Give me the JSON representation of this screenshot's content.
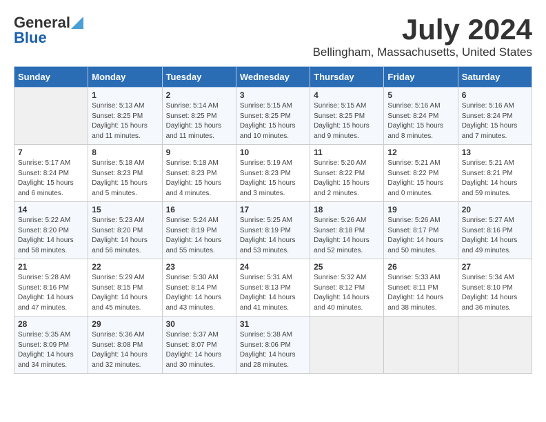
{
  "header": {
    "logo_general": "General",
    "logo_blue": "Blue",
    "month": "July 2024",
    "location": "Bellingham, Massachusetts, United States"
  },
  "weekdays": [
    "Sunday",
    "Monday",
    "Tuesday",
    "Wednesday",
    "Thursday",
    "Friday",
    "Saturday"
  ],
  "weeks": [
    [
      {
        "day": "",
        "empty": true
      },
      {
        "day": "1",
        "sunrise": "Sunrise: 5:13 AM",
        "sunset": "Sunset: 8:25 PM",
        "daylight": "Daylight: 15 hours and 11 minutes."
      },
      {
        "day": "2",
        "sunrise": "Sunrise: 5:14 AM",
        "sunset": "Sunset: 8:25 PM",
        "daylight": "Daylight: 15 hours and 11 minutes."
      },
      {
        "day": "3",
        "sunrise": "Sunrise: 5:15 AM",
        "sunset": "Sunset: 8:25 PM",
        "daylight": "Daylight: 15 hours and 10 minutes."
      },
      {
        "day": "4",
        "sunrise": "Sunrise: 5:15 AM",
        "sunset": "Sunset: 8:25 PM",
        "daylight": "Daylight: 15 hours and 9 minutes."
      },
      {
        "day": "5",
        "sunrise": "Sunrise: 5:16 AM",
        "sunset": "Sunset: 8:24 PM",
        "daylight": "Daylight: 15 hours and 8 minutes."
      },
      {
        "day": "6",
        "sunrise": "Sunrise: 5:16 AM",
        "sunset": "Sunset: 8:24 PM",
        "daylight": "Daylight: 15 hours and 7 minutes."
      }
    ],
    [
      {
        "day": "7",
        "sunrise": "Sunrise: 5:17 AM",
        "sunset": "Sunset: 8:24 PM",
        "daylight": "Daylight: 15 hours and 6 minutes."
      },
      {
        "day": "8",
        "sunrise": "Sunrise: 5:18 AM",
        "sunset": "Sunset: 8:23 PM",
        "daylight": "Daylight: 15 hours and 5 minutes."
      },
      {
        "day": "9",
        "sunrise": "Sunrise: 5:18 AM",
        "sunset": "Sunset: 8:23 PM",
        "daylight": "Daylight: 15 hours and 4 minutes."
      },
      {
        "day": "10",
        "sunrise": "Sunrise: 5:19 AM",
        "sunset": "Sunset: 8:23 PM",
        "daylight": "Daylight: 15 hours and 3 minutes."
      },
      {
        "day": "11",
        "sunrise": "Sunrise: 5:20 AM",
        "sunset": "Sunset: 8:22 PM",
        "daylight": "Daylight: 15 hours and 2 minutes."
      },
      {
        "day": "12",
        "sunrise": "Sunrise: 5:21 AM",
        "sunset": "Sunset: 8:22 PM",
        "daylight": "Daylight: 15 hours and 0 minutes."
      },
      {
        "day": "13",
        "sunrise": "Sunrise: 5:21 AM",
        "sunset": "Sunset: 8:21 PM",
        "daylight": "Daylight: 14 hours and 59 minutes."
      }
    ],
    [
      {
        "day": "14",
        "sunrise": "Sunrise: 5:22 AM",
        "sunset": "Sunset: 8:20 PM",
        "daylight": "Daylight: 14 hours and 58 minutes."
      },
      {
        "day": "15",
        "sunrise": "Sunrise: 5:23 AM",
        "sunset": "Sunset: 8:20 PM",
        "daylight": "Daylight: 14 hours and 56 minutes."
      },
      {
        "day": "16",
        "sunrise": "Sunrise: 5:24 AM",
        "sunset": "Sunset: 8:19 PM",
        "daylight": "Daylight: 14 hours and 55 minutes."
      },
      {
        "day": "17",
        "sunrise": "Sunrise: 5:25 AM",
        "sunset": "Sunset: 8:19 PM",
        "daylight": "Daylight: 14 hours and 53 minutes."
      },
      {
        "day": "18",
        "sunrise": "Sunrise: 5:26 AM",
        "sunset": "Sunset: 8:18 PM",
        "daylight": "Daylight: 14 hours and 52 minutes."
      },
      {
        "day": "19",
        "sunrise": "Sunrise: 5:26 AM",
        "sunset": "Sunset: 8:17 PM",
        "daylight": "Daylight: 14 hours and 50 minutes."
      },
      {
        "day": "20",
        "sunrise": "Sunrise: 5:27 AM",
        "sunset": "Sunset: 8:16 PM",
        "daylight": "Daylight: 14 hours and 49 minutes."
      }
    ],
    [
      {
        "day": "21",
        "sunrise": "Sunrise: 5:28 AM",
        "sunset": "Sunset: 8:16 PM",
        "daylight": "Daylight: 14 hours and 47 minutes."
      },
      {
        "day": "22",
        "sunrise": "Sunrise: 5:29 AM",
        "sunset": "Sunset: 8:15 PM",
        "daylight": "Daylight: 14 hours and 45 minutes."
      },
      {
        "day": "23",
        "sunrise": "Sunrise: 5:30 AM",
        "sunset": "Sunset: 8:14 PM",
        "daylight": "Daylight: 14 hours and 43 minutes."
      },
      {
        "day": "24",
        "sunrise": "Sunrise: 5:31 AM",
        "sunset": "Sunset: 8:13 PM",
        "daylight": "Daylight: 14 hours and 41 minutes."
      },
      {
        "day": "25",
        "sunrise": "Sunrise: 5:32 AM",
        "sunset": "Sunset: 8:12 PM",
        "daylight": "Daylight: 14 hours and 40 minutes."
      },
      {
        "day": "26",
        "sunrise": "Sunrise: 5:33 AM",
        "sunset": "Sunset: 8:11 PM",
        "daylight": "Daylight: 14 hours and 38 minutes."
      },
      {
        "day": "27",
        "sunrise": "Sunrise: 5:34 AM",
        "sunset": "Sunset: 8:10 PM",
        "daylight": "Daylight: 14 hours and 36 minutes."
      }
    ],
    [
      {
        "day": "28",
        "sunrise": "Sunrise: 5:35 AM",
        "sunset": "Sunset: 8:09 PM",
        "daylight": "Daylight: 14 hours and 34 minutes."
      },
      {
        "day": "29",
        "sunrise": "Sunrise: 5:36 AM",
        "sunset": "Sunset: 8:08 PM",
        "daylight": "Daylight: 14 hours and 32 minutes."
      },
      {
        "day": "30",
        "sunrise": "Sunrise: 5:37 AM",
        "sunset": "Sunset: 8:07 PM",
        "daylight": "Daylight: 14 hours and 30 minutes."
      },
      {
        "day": "31",
        "sunrise": "Sunrise: 5:38 AM",
        "sunset": "Sunset: 8:06 PM",
        "daylight": "Daylight: 14 hours and 28 minutes."
      },
      {
        "day": "",
        "empty": true
      },
      {
        "day": "",
        "empty": true
      },
      {
        "day": "",
        "empty": true
      }
    ]
  ]
}
